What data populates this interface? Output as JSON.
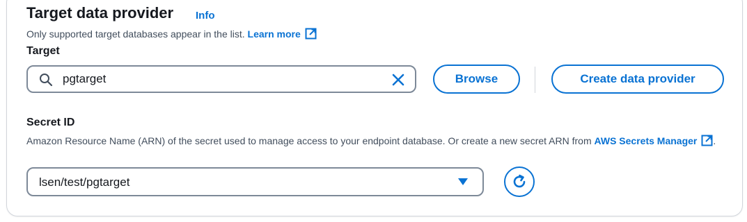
{
  "section": {
    "title": "Target data provider",
    "info_link": "Info",
    "description": "Only supported target databases appear in the list.",
    "learn_more": "Learn more"
  },
  "target": {
    "label": "Target",
    "search_value": "pgtarget",
    "browse_label": "Browse",
    "create_label": "Create data provider"
  },
  "secret": {
    "label": "Secret ID",
    "description": "Amazon Resource Name (ARN) of the secret used to manage access to your endpoint database. Or create a new secret ARN from",
    "link_text": "AWS Secrets Manager",
    "trailing": ".",
    "selected_value": "lsen/test/pgtarget"
  },
  "icons": {
    "search": "search-icon",
    "clear": "close-icon",
    "external": "external-link-icon",
    "dropdown": "caret-down-icon",
    "refresh": "refresh-icon"
  },
  "colors": {
    "link": "#0972d3",
    "text": "#16191f",
    "secondary_text": "#414d5c",
    "border": "#7d8998"
  }
}
